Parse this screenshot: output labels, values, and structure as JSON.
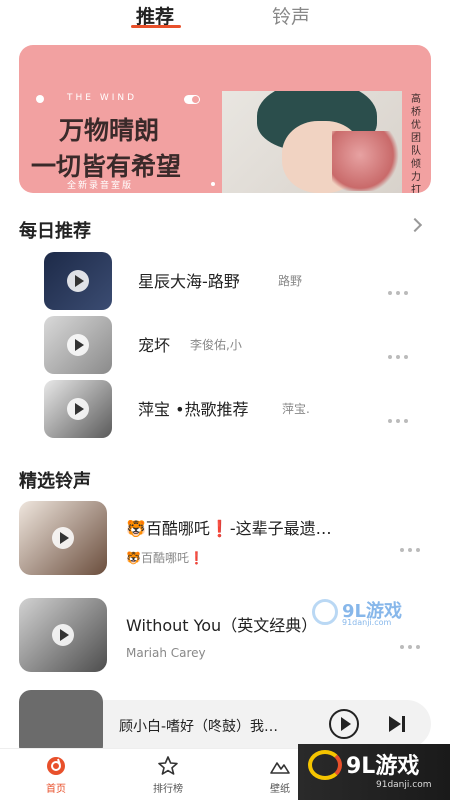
{
  "tabs": {
    "active": "推荐",
    "other": "铃声"
  },
  "banner": {
    "brand": "THE WIND",
    "line1": "万物晴朗",
    "line2": "一切皆有希望",
    "edition": "全新录音室版",
    "side_text": "高桥优团队倾力打造"
  },
  "daily": {
    "title": "每日推荐",
    "songs": [
      {
        "title": "星辰大海-路野",
        "artist": "路野"
      },
      {
        "title": "宠坏",
        "artist": "李俊佑,小"
      },
      {
        "title": "萍宝 •热歌推荐",
        "artist": "萍宝."
      }
    ]
  },
  "ringtones": {
    "title": "精选铃声",
    "items": [
      {
        "title": "🐯百酷哪吒❗-这辈子最遗…",
        "sub": "🐯百酷哪吒❗"
      },
      {
        "title": "Without You（英文经典）",
        "sub": "Mariah Carey"
      }
    ]
  },
  "player": {
    "title": "顾小白-嗜好（咚鼓）我…"
  },
  "nav": {
    "home": "首页",
    "rank": "排行榜",
    "wallpaper": "壁纸"
  },
  "watermark": {
    "brand": "9L游戏",
    "site": "91danji.com"
  },
  "colors": {
    "accent": "#e8502b",
    "banner": "#f2a1a1"
  }
}
